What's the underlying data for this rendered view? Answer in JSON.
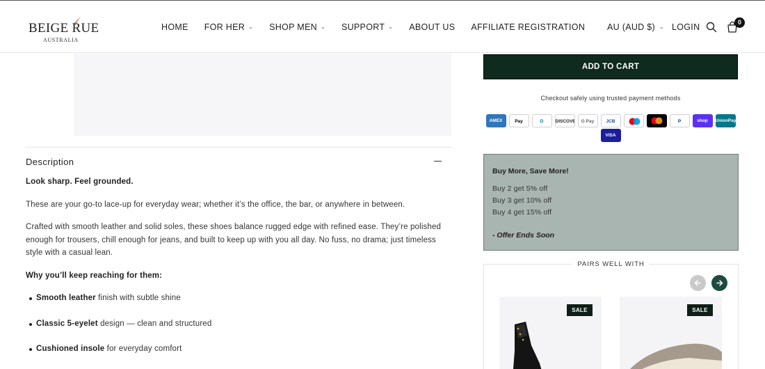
{
  "header": {
    "brand": "BEIGE RUE",
    "brand_sub": "AUSTRALIA",
    "nav": [
      {
        "label": "HOME",
        "has_dropdown": false
      },
      {
        "label": "FOR HER",
        "has_dropdown": true
      },
      {
        "label": "SHOP MEN",
        "has_dropdown": true
      },
      {
        "label": "SUPPORT",
        "has_dropdown": true
      },
      {
        "label": "ABOUT US",
        "has_dropdown": false
      },
      {
        "label": "AFFILIATE REGISTRATION",
        "has_dropdown": false
      }
    ],
    "currency": "AU (AUD $)",
    "login": "LOGIN",
    "cart_count": "0"
  },
  "description": {
    "heading": "Description",
    "tagline": "Look sharp. Feel grounded.",
    "para1": "These are your go-to lace-up for everyday wear; whether it’s the office, the bar, or anywhere in between.",
    "para2": "Crafted with smooth leather and solid soles, these shoes balance rugged edge with refined ease. They’re polished enough for trousers, chill enough for jeans, and built to keep up with you all day. No fuss, no drama; just timeless style with a casual lean.",
    "reasons_heading": "Why you’ll keep reaching for them:",
    "bullets": [
      {
        "bold": "Smooth leather",
        "rest": " finish with subtle shine"
      },
      {
        "bold": "Classic 5-eyelet",
        "rest": " design — clean and structured"
      },
      {
        "bold": "Cushioned insole",
        "rest": " for everyday comfort"
      }
    ]
  },
  "purchase": {
    "add_to_cart": "ADD TO CART",
    "checkout_text": "Checkout safely using trusted payment methods",
    "payment_methods": [
      {
        "name": "AMEX",
        "bg": "#2e77bc",
        "fg": "#ffffff"
      },
      {
        "name": "Pay",
        "bg": "#ffffff",
        "fg": "#000000"
      },
      {
        "name": "D",
        "bg": "#ffffff",
        "fg": "#0079be"
      },
      {
        "name": "DISCOVER",
        "bg": "#ffffff",
        "fg": "#222222"
      },
      {
        "name": "G Pay",
        "bg": "#ffffff",
        "fg": "#5f6368"
      },
      {
        "name": "JCB",
        "bg": "#ffffff",
        "fg": "#0e4c96"
      },
      {
        "name": "maestro",
        "bg": "#ffffff",
        "fg": "#6c6bbd"
      },
      {
        "name": "mc",
        "bg": "#000000",
        "fg": "#ff5f00"
      },
      {
        "name": "P",
        "bg": "#ffffff",
        "fg": "#003087"
      },
      {
        "name": "shop",
        "bg": "#5a31f4",
        "fg": "#ffffff"
      },
      {
        "name": "UnionPay",
        "bg": "#01798a",
        "fg": "#ffffff"
      },
      {
        "name": "VISA",
        "bg": "#1a1f9c",
        "fg": "#ffffff"
      }
    ]
  },
  "promo": {
    "title": "Buy More, Save More!",
    "lines": [
      "Buy 2 get 5% off",
      "Buy 3 get 10% off",
      "Buy 4 get 15% off"
    ],
    "ends": "- Offer Ends Soon"
  },
  "pairs": {
    "heading": "PAIRS WELL WITH",
    "products": [
      {
        "badge": "SALE"
      },
      {
        "badge": "SALE"
      }
    ]
  }
}
